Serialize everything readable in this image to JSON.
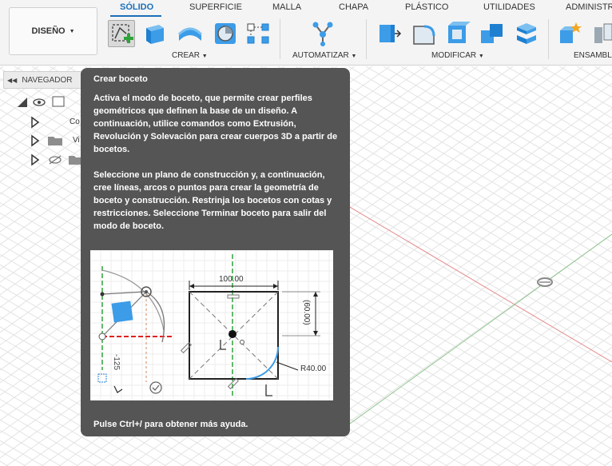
{
  "toolbar": {
    "workspace_label": "DISEÑO",
    "tabs": [
      {
        "label": "SÓLIDO",
        "active": true
      },
      {
        "label": "SUPERFICIE",
        "active": false
      },
      {
        "label": "MALLA",
        "active": false
      },
      {
        "label": "CHAPA",
        "active": false
      },
      {
        "label": "PLÁSTICO",
        "active": false
      },
      {
        "label": "UTILIDADES",
        "active": false
      },
      {
        "label": "ADMINISTRAR",
        "active": false
      }
    ],
    "groups": {
      "crear": "CREAR",
      "automatizar": "AUTOMATIZAR",
      "modificar": "MODIFICAR",
      "ensamblar": "ENSAMBL"
    },
    "accent_color": "#1b6fb8"
  },
  "navigator": {
    "title": "NAVEGADOR",
    "items": [
      {
        "label": "Co"
      },
      {
        "label": "Vi"
      }
    ]
  },
  "tooltip": {
    "title": "Crear boceto",
    "paragraph1": "Activa el modo de boceto, que permite crear perfiles geométricos que definen la base de un diseño. A continuación, utilice comandos como Extrusión, Revolución y Solevación para crear cuerpos 3D a partir de bocetos.",
    "paragraph2": "Seleccione un plano de construcción y, a continuación, cree líneas, arcos o puntos para crear la geometría de boceto y construcción. Restrinja los bocetos con cotas y restricciones. Seleccione Terminar boceto para salir del modo de boceto.",
    "footer": "Pulse Ctrl+/ para obtener más ayuda.",
    "illustration": {
      "dim_width": "100.00",
      "dim_height": "(60.00)",
      "dim_radius": "R40.00",
      "dim_left": "-125"
    }
  }
}
